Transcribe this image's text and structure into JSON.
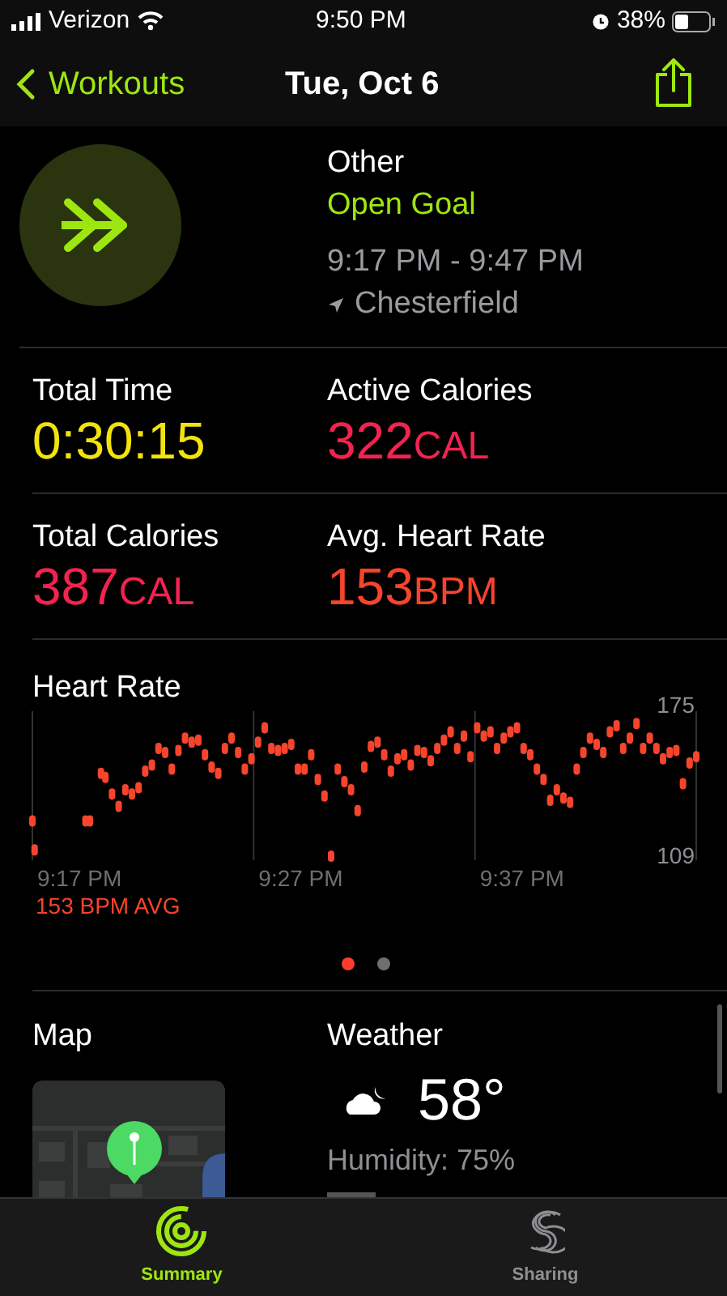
{
  "status_bar": {
    "carrier": "Verizon",
    "time": "9:50 PM",
    "battery": "38%"
  },
  "nav": {
    "back_label": "Workouts",
    "title": "Tue, Oct 6"
  },
  "workout": {
    "name": "Other",
    "goal": "Open Goal",
    "time_range": "9:17 PM - 9:47 PM",
    "location": "Chesterfield"
  },
  "metrics": [
    {
      "label": "Total Time",
      "value": "0:30:15",
      "color": "#f2e30f"
    },
    {
      "label": "Active Calories",
      "value": "322",
      "unit": "CAL",
      "color": "#f2234f"
    },
    {
      "label": "Total Calories",
      "value": "387",
      "unit": "CAL",
      "color": "#f2234f"
    },
    {
      "label": "Avg. Heart Rate",
      "value": "153",
      "unit": "BPM",
      "color": "#f7442c"
    }
  ],
  "heart_rate": {
    "title": "Heart Rate",
    "max_label": "175",
    "min_label": "109",
    "time_labels": [
      "9:17 PM",
      "9:27 PM",
      "9:37 PM"
    ],
    "average": "153 BPM AVG"
  },
  "page_dots": [
    {
      "selected": true
    },
    {
      "selected": false
    }
  ],
  "map": {
    "title": "Map"
  },
  "weather": {
    "title": "Weather",
    "temperature": "58°",
    "humidity": "Humidity: 75%"
  },
  "tabs": [
    {
      "label": "Summary",
      "selected": true
    },
    {
      "label": "Sharing",
      "selected": false
    }
  ]
}
